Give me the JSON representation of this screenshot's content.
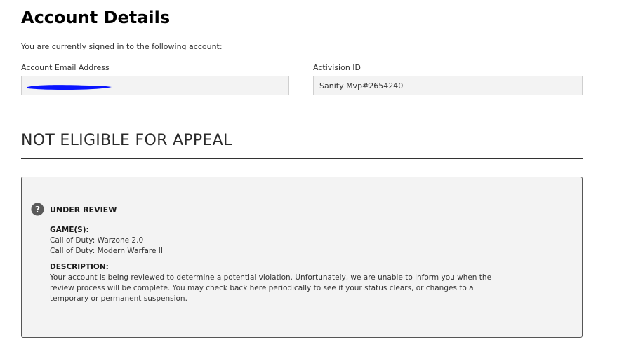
{
  "page": {
    "title": "Account Details",
    "signed_in_text": "You are currently signed in to the following account:"
  },
  "account": {
    "email_label": "Account Email Address",
    "email_value": "",
    "activision_id_label": "Activision ID",
    "activision_id_value": "Sanity Mvp#2654240"
  },
  "eligibility": {
    "heading": "NOT ELIGIBLE FOR APPEAL"
  },
  "status": {
    "icon": "question-circle-icon",
    "title": "UNDER REVIEW",
    "games_heading": "GAME(S):",
    "games": [
      "Call of Duty: Warzone 2.0",
      "Call of Duty: Modern Warfare II"
    ],
    "description_heading": "DESCRIPTION:",
    "description": "Your account is being reviewed to determine a potential violation. Unfortunately, we are unable to inform you when the review process will be complete. You may check back here periodically to see if your status clears, or changes to a temporary or permanent suspension."
  },
  "colors": {
    "redaction": "#0a14ff",
    "panel_background": "#f3f3f3",
    "icon": "#5a5a5a"
  }
}
